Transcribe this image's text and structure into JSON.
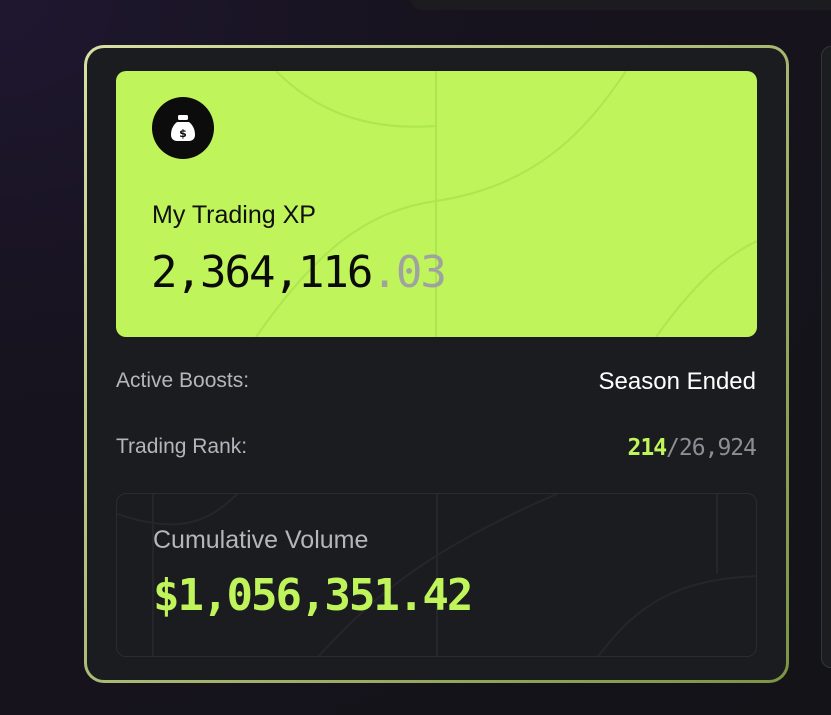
{
  "xp_card": {
    "icon": "money-bag-icon",
    "label": "My Trading XP",
    "value_whole": "2,364,116",
    "value_decimal": ".03"
  },
  "active_boosts": {
    "label": "Active Boosts:",
    "value": "Season Ended"
  },
  "trading_rank": {
    "label": "Trading Rank:",
    "rank": "214",
    "separator": "/",
    "total": "26,924"
  },
  "cumulative_volume": {
    "label": "Cumulative Volume",
    "value": "$1,056,351.42"
  },
  "colors": {
    "accent": "#bff45a",
    "card_background": "#1b1c20",
    "muted_text": "#b4b6bd"
  }
}
